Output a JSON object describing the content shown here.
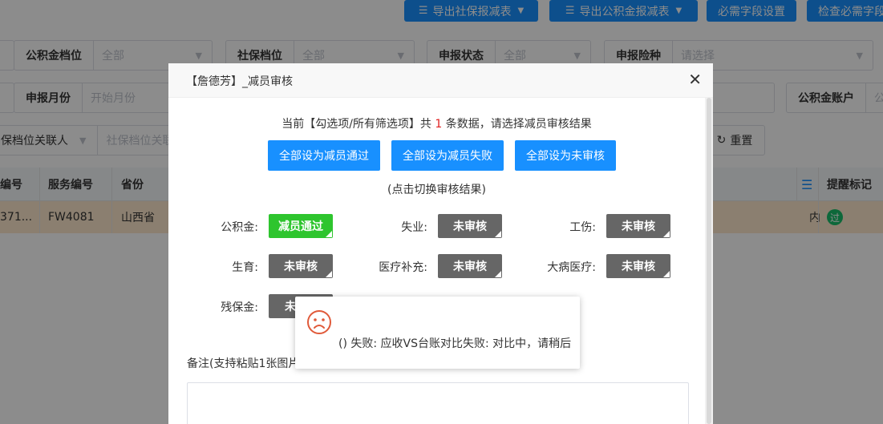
{
  "toolbar": {
    "btn_export_social": "导出社保报减表",
    "btn_export_fund": "导出公积金报减表",
    "btn_required_fields": "必需字段设置",
    "btn_check_required": "检查必需字段"
  },
  "filters": {
    "fund_file": {
      "label": "公积金档位",
      "value": "全部"
    },
    "social_file": {
      "label": "社保档位",
      "value": "全部"
    },
    "declare_status": {
      "label": "申报状态",
      "value": "全部"
    },
    "declare_insurance": {
      "label": "申报险种",
      "placeholder": "请选择"
    },
    "declare_month": {
      "label": "申报月份",
      "placeholder": "开始月份"
    },
    "fund_account": {
      "label": "公积金账户",
      "placeholder": "公"
    },
    "social_contact": {
      "label": "保档位关联人",
      "placeholder": "社保档位关联"
    },
    "reset_label": "重置"
  },
  "table": {
    "headers": [
      "编号",
      "服务编号",
      "省份",
      "提醒标记"
    ],
    "row": {
      "id": "371...",
      "service_no": "FW4081",
      "province": "山西省",
      "col_tail": "内",
      "badge": "过"
    }
  },
  "modal": {
    "title": "【詹德芳】_减员审核",
    "info_prefix": "当前【勾选项/所有筛选项】共",
    "info_count": "1",
    "info_suffix": "条数据，请选择减员审核结果",
    "btn_all_pass": "全部设为减员通过",
    "btn_all_fail": "全部设为减员失败",
    "btn_all_unreviewed": "全部设为未审核",
    "hint": "(点击切换审核结果)",
    "items": {
      "fund": {
        "label": "公积金:",
        "status": "减员通过"
      },
      "unemployment": {
        "label": "失业:",
        "status": "未审核"
      },
      "injury": {
        "label": "工伤:",
        "status": "未审核"
      },
      "maternity": {
        "label": "生育:",
        "status": "未审核"
      },
      "medical_supplement": {
        "label": "医疗补充:",
        "status": "未审核"
      },
      "critical_illness": {
        "label": "大病医疗:",
        "status": "未审核"
      },
      "disability_fund": {
        "label": "残保金:",
        "status": "未"
      }
    },
    "remark_label": "备注(支持粘贴1张图片"
  },
  "toast": {
    "message": "() 失败: 应收VS台账对比失败: 对比中，请稍后"
  },
  "colors": {
    "primary": "#1890ff",
    "pass": "#2ec52e",
    "unreviewed": "#666666",
    "error": "#e02020",
    "row_highlight": "#fde8cc"
  }
}
